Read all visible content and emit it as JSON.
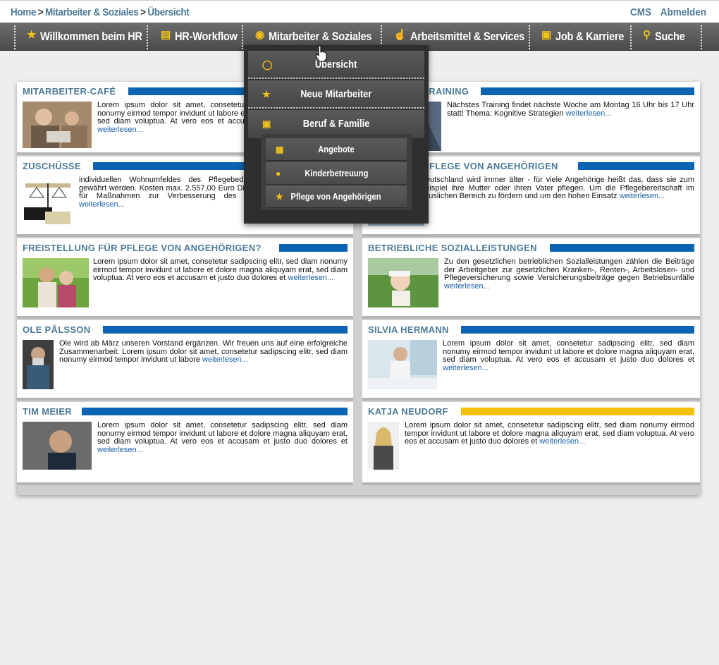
{
  "breadcrumb": {
    "items": [
      "Home",
      "Mitarbeiter & Soziales",
      "Übersicht"
    ],
    "separator": ">"
  },
  "toplinks": {
    "cms": "CMS",
    "logout": "Abmelden"
  },
  "nav": {
    "items": [
      {
        "label": "Willkommen beim HR",
        "icon": "group-icon"
      },
      {
        "label": "HR-Workflow",
        "icon": "document-icon"
      },
      {
        "label": "Mitarbeiter & Soziales",
        "icon": "target-icon"
      },
      {
        "label": "Arbeitsmittel & Services",
        "icon": "thumbs-up-icon"
      },
      {
        "label": "Job & Karriere",
        "icon": "id-card-icon"
      },
      {
        "label": "Suche",
        "icon": "search-icon"
      }
    ]
  },
  "dropdown": {
    "items": [
      {
        "label": "Übersicht",
        "icon": "lightbulb-icon"
      },
      {
        "label": "Neue Mitarbeiter",
        "icon": "group-icon"
      },
      {
        "label": "Beruf & Familie",
        "icon": "id-card-icon"
      }
    ],
    "subitems": [
      {
        "label": "Angebote",
        "icon": "calendar-icon"
      },
      {
        "label": "Kinderbetreuung",
        "icon": "person-icon"
      },
      {
        "label": "Pflege von Angehörigen",
        "icon": "group-icon"
      }
    ]
  },
  "cards": [
    {
      "title": "MITARBEITER-CAFÉ",
      "text": "Lorem ipsum dolor sit amet, consetetur sadipscing elitr, sed diam nonumy eirmod tempor invidunt ut labore et dolore magna aliquyam erat, sed diam voluptua. At vero eos et accusam et justo duo dolores et",
      "more": "weiterlesen..."
    },
    {
      "title": "TRAINING",
      "text": "Nächstes Training findet nächste Woche am Montag 16 Uhr bis 17 Uhr statt! Thema: Kognitive Strategien",
      "more": "weiterlesen..."
    },
    {
      "title": "ZUSCHÜSSE",
      "text": "individuellen Wohnumfeldes des Pflegebedürftigen können Zuschüsse gewährt werden. Kosten max. 2.557,00 Euro Die Zuschüsse der Pflegekasse für Maßnahmen zur Verbesserung des individuellen Wohnumfeldes",
      "more": "weiterlesen..."
    },
    {
      "title": "PFLEGE VON ANGEHÖRIGEN",
      "text": "Deutschland wird immer älter - für viele Angehörige heißt das, dass sie zum Beispiel ihre Mutter oder ihren Vater pflegen. Um die Pflegebereitschaft im häuslichen Bereich zu fördern und um den hohen Einsatz",
      "more": "weiterlesen..."
    },
    {
      "title": "FREISTELLUNG FÜR PFLEGE VON ANGEHÖRIGEN?",
      "text": "Lorem ipsum dolor sit amet, consetetur sadipscing elitr, sed diam nonumy eirmod tempor invidunt ut labore et dolore magna aliquyam erat, sed diam voluptua. At vero eos et accusam et justo duo dolores et",
      "more": "weiterlesen..."
    },
    {
      "title": "BETRIEBLICHE SOZIALLEISTUNGEN",
      "text": "Zu den gesetzlichen betrieblichen Sozialleistungen zählen die Beiträge der Arbeitgeber zur gesetzlichen Kranken-, Renten-, Arbeitslosen- und Pflegeversicherung sowie Versicherungsbeiträge gegen Betriebsunfälle",
      "more": "weiterlesen..."
    },
    {
      "title": "OLE PÅLSSON",
      "text": "Ole wird ab März unseren Vorstand ergänzen. Wir freuen uns auf eine erfolgreiche Zusammenarbeit. Lorem ipsum dolor sit amet, consetetur sadipscing elitr, sed diam nonumy eirmod tempor invidunt ut labore",
      "more": "weiterlesen..."
    },
    {
      "title": "SILVIA HERMANN",
      "text": "Lorem ipsum dolor sit amet, consetetur sadipscing elitr, sed diam nonumy eirmod tempor invidunt ut labore et dolore magna aliquyam erat, sed diam voluptua. At vero eos et accusam et justo duo dolores et",
      "more": "weiterlesen..."
    },
    {
      "title": "TIM MEIER",
      "text": "Lorem ipsum dolor sit amet, consetetur sadipscing elitr, sed diam nonumy eirmod tempor invidunt ut labore et dolore magna aliquyam erat, sed diam voluptua. At vero eos et accusam et justo duo dolores et",
      "more": "weiterlesen..."
    },
    {
      "title": "KATJA NEUDORF",
      "text": "Lorem ipsum dolor sit amet, consetetur sadipscing elitr, sed diam nonumy eirmod tempor invidunt ut labore et dolore magna aliquyam erat, sed diam voluptua. At vero eos et accusam et justo duo dolores et",
      "more": "weiterlesen..."
    }
  ],
  "colors": {
    "accent": "#0a63b3",
    "highlight": "#f5c000",
    "link": "#1c5fa6",
    "title": "#4e7a96",
    "nav": "#555555"
  }
}
